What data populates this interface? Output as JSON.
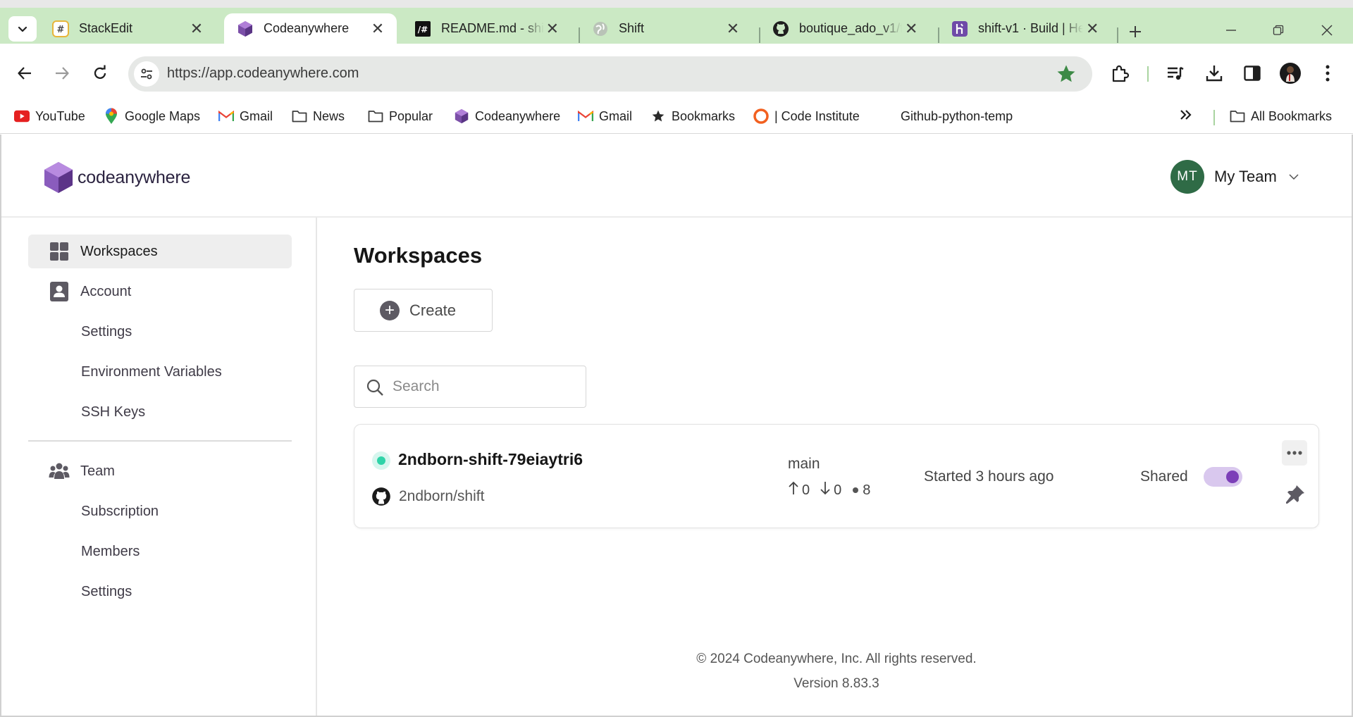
{
  "browser": {
    "tabs": [
      {
        "title": "StackEdit",
        "icon": "stackedit-icon",
        "active": false
      },
      {
        "title": "Codeanywhere",
        "icon": "codeanywhere-icon",
        "active": true
      },
      {
        "title": "README.md - shift",
        "icon": "stackedit-dark-icon",
        "active": false
      },
      {
        "title": "Shift",
        "icon": "globe-icon",
        "active": false
      },
      {
        "title": "boutique_ado_v1/f",
        "icon": "github-icon",
        "active": false
      },
      {
        "title": "shift-v1 · Build | He",
        "icon": "heroku-icon",
        "active": false
      }
    ],
    "url": "https://app.codeanywhere.com",
    "bookmarks": [
      {
        "label": "YouTube",
        "icon": "youtube-icon"
      },
      {
        "label": "Google Maps",
        "icon": "maps-pin-icon"
      },
      {
        "label": "Gmail",
        "icon": "gmail-icon"
      },
      {
        "label": "News",
        "icon": "folder-icon"
      },
      {
        "label": "Popular",
        "icon": "folder-icon"
      },
      {
        "label": "Codeanywhere",
        "icon": "codeanywhere-icon"
      },
      {
        "label": "Gmail",
        "icon": "gmail-icon"
      },
      {
        "label": "Bookmarks",
        "icon": "star-icon"
      },
      {
        "label": "| Code Institute",
        "icon": "code-institute-icon"
      },
      {
        "label": "Github-python-temp",
        "icon": ""
      }
    ],
    "all_bookmarks": "All Bookmarks",
    "colors": {
      "tabbar": "#cbe9c4",
      "omnibox": "#e6e8e6",
      "star": "#3d8a46"
    }
  },
  "app": {
    "logo_text": "codeanywhere",
    "team": {
      "initials": "MT",
      "name": "My Team",
      "avatar_color": "#2f6b46"
    },
    "sidebar": {
      "workspaces": "Workspaces",
      "account": "Account",
      "account_settings": "Settings",
      "environment_variables": "Environment Variables",
      "ssh_keys": "SSH Keys",
      "team": "Team",
      "subscription": "Subscription",
      "members": "Members",
      "team_settings": "Settings"
    },
    "main": {
      "title": "Workspaces",
      "create_label": "Create",
      "search_placeholder": "Search",
      "workspace": {
        "name": "2ndborn-shift-79eiaytri6",
        "repo": "2ndborn/shift",
        "branch": "main",
        "ahead": "0",
        "behind": "0",
        "changes": "8",
        "started": "Started 3 hours ago",
        "shared_label": "Shared",
        "shared": true,
        "status_color": "#2fd3a8",
        "accent": "#7c3fb8"
      }
    },
    "footer": {
      "copyright": "© 2024 Codeanywhere, Inc. All rights reserved.",
      "version": "Version 8.83.3"
    }
  }
}
